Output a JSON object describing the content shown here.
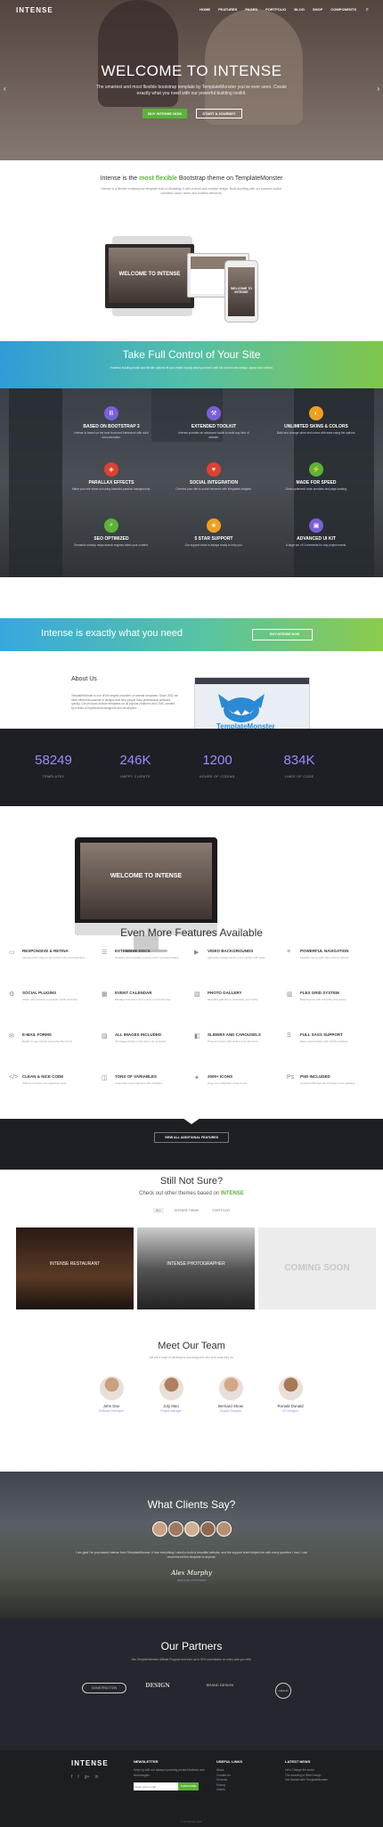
{
  "nav": {
    "logo": "INTENSE",
    "items": [
      "HOME",
      "FEATURES",
      "PAGES",
      "PORTFOLIO",
      "BLOG",
      "SHOP",
      "COMPONENTS"
    ]
  },
  "hero": {
    "title": "WELCOME TO INTENSE",
    "subtitle": "The smartest and most flexible bootstrap template by TemplateMonster you've ever seen. Create exactly what you need with our powerful building toolkit.",
    "btn_primary": "BUY INTENSE NOW",
    "btn_secondary": "START A JOURNEY"
  },
  "intro": {
    "heading_prefix": "Intense is the ",
    "heading_em": "most flexible",
    "heading_suffix": " Bootstrap theme on TemplateMonster",
    "body": "Intense is a flexible multipurpose template built on Bootstrap 3 with a clean and creative design. Build anything with our powerful toolkit, unlimited colors, skins, and endless elements."
  },
  "control": {
    "title": "Take Full Control of Your Site",
    "subtitle": "Powerful building toolkit and flexible options let you create exactly what you need, with full control over design, layout and content."
  },
  "features": [
    {
      "title": "BASED ON BOOTSTRAP 3",
      "desc": "Intense is based on the best front-end framework with solid documentation.",
      "color": "#7a5fd6",
      "icon": "bootstrap-icon"
    },
    {
      "title": "EXTENDED TOOLKIT",
      "desc": "Intense provides an advanced toolkit to build any kind of website.",
      "color": "#7a5fd6",
      "icon": "toolkit-icon"
    },
    {
      "title": "UNLIMITED SKINS & COLORS",
      "desc": "Build and change skins and colors with ease using the options.",
      "color": "#f0a020",
      "icon": "palette-icon"
    },
    {
      "title": "PARALLAX EFFECTS",
      "desc": "Make your site stand out using beautiful parallax backgrounds.",
      "color": "#e04030",
      "icon": "parallax-icon"
    },
    {
      "title": "SOCIAL INTEGRATION",
      "desc": "Connect your site to social networks with integrated widgets.",
      "color": "#e04030",
      "icon": "social-icon"
    },
    {
      "title": "MADE FOR SPEED",
      "desc": "Clean optimized code provides fast page loading.",
      "color": "#5bb33a",
      "icon": "speed-icon"
    },
    {
      "title": "SEO OPTIMIZED",
      "desc": "Semantic markup helps search engines index your content.",
      "color": "#5bb33a",
      "icon": "seo-icon"
    },
    {
      "title": "5 STAR SUPPORT",
      "desc": "Our support team is always ready to help you.",
      "color": "#f0a020",
      "icon": "support-icon"
    },
    {
      "title": "ADVANCED UI KIT",
      "desc": "A large set of UI elements for any project needs.",
      "color": "#7a5fd6",
      "icon": "uikit-icon"
    }
  ],
  "cta": {
    "title": "Intense is exactly what you need",
    "button": "BUY INTENSE NOW"
  },
  "about": {
    "title": "About Us",
    "body": "TemplateMonster is one of the largest providers of website templates. Since 2002 we have offered thousands of designs that help people build professional websites quickly. Our products include templates for all popular platforms and CMS, created by a team of experienced designers and developers.",
    "video_brand": "TemplateMonster"
  },
  "stats": [
    {
      "value": "58249",
      "label": "TEMPLATES"
    },
    {
      "value": "246K",
      "label": "HAPPY CLIENTS"
    },
    {
      "value": "1200",
      "label": "HOURS OF CODING"
    },
    {
      "value": "834K",
      "label": "LINES OF CODE"
    }
  ],
  "more_features": {
    "title": "Even More Features Available",
    "items": [
      {
        "title": "RESPONSIVE & RETINA",
        "desc": "Intense looks crisp on any screen size and resolution."
      },
      {
        "title": "EXTENSIVE DOCS",
        "desc": "Detailed documentation covers every template feature."
      },
      {
        "title": "VIDEO BACKGROUNDS",
        "desc": "Add video backgrounds to any section with ease."
      },
      {
        "title": "POWERFUL NAVIGATION",
        "desc": "Flexible menus with many layout options."
      },
      {
        "title": "SOCIAL PLUGINS",
        "desc": "Share your content on popular social networks."
      },
      {
        "title": "EVENT CALENDAR",
        "desc": "Manage and share your events in a simple way."
      },
      {
        "title": "PHOTO GALLERY",
        "desc": "Beautiful galleries to showcase your works."
      },
      {
        "title": "FLEX GRID SYSTEM",
        "desc": "Build layouts with a flexible grid system."
      },
      {
        "title": "E-MAIL FORMS",
        "desc": "Ready to use contact and subscribe forms."
      },
      {
        "title": "ALL IMAGES INCLUDED",
        "desc": "All images shown in the demo are included."
      },
      {
        "title": "SLIDERS AND CAROUSELS",
        "desc": "Present content with sliders and carousels."
      },
      {
        "title": "FULL SASS SUPPORT",
        "desc": "Easy customization with SASS variables."
      },
      {
        "title": "CLEAN & NICE CODE",
        "desc": "Well commented and organized code."
      },
      {
        "title": "TONS OF VARIABLES",
        "desc": "Customize every element with variables."
      },
      {
        "title": "2000+ ICONS",
        "desc": "Huge icon collection ready to use."
      },
      {
        "title": "PSD INCLUDED",
        "desc": "Layered PSD files are included in the package."
      }
    ],
    "button": "VIEW ALL ADDITIONAL FEATURES"
  },
  "not_sure": {
    "title": "Still Not Sure?",
    "sub_prefix": "Check out other themes based on ",
    "sub_em": "INTENSE",
    "tabs": [
      "ALL",
      "INTENSE THEME",
      "PORTFOLIO"
    ],
    "thumbs": [
      "INTENSE RESTAURANT",
      "INTENSE PHOTOGRAPHER",
      "COMING SOON"
    ]
  },
  "team": {
    "title": "Meet Our Team",
    "subtitle": "We are a team of developers and designers who love what they do.",
    "members": [
      {
        "name": "John Doe",
        "role": "Software Developer"
      },
      {
        "name": "July Mao",
        "role": "Project Manager"
      },
      {
        "name": "Bernard Show",
        "role": "Graphic Designer"
      },
      {
        "name": "Ronald Donald",
        "role": "UX Designer"
      }
    ]
  },
  "clients": {
    "title": "What Clients Say?",
    "quote": "I am glad I've purchased Intense from TemplateMonster. It has everything I need to build a beautiful website, and the support team helped me with every question I had. I can recommend this template to anyone.",
    "name": "Alex Murphy",
    "role": "REGULAR CUSTOMER"
  },
  "partners": {
    "title": "Our Partners",
    "subtitle": "Join TemplateMonster Affiliate Program and earn up to 30% commission on every sale you refer.",
    "logos": [
      "CONSTRUCTION",
      "DESIGN",
      "BRAND DESIGN",
      "GROUP"
    ]
  },
  "footer": {
    "logo": "INTENSE",
    "newsletter_title": "NEWSLETTER",
    "newsletter_text": "Keep up with our always upcoming product features and technologies.",
    "input_placeholder": "Enter your e-mail",
    "subscribe": "SUBSCRIBE",
    "links_title": "USEFUL LINKS",
    "links": [
      "About",
      "Contact Us",
      "Services",
      "Pricing",
      "Clients"
    ],
    "news_title": "LATEST NEWS",
    "news": [
      "Let's Change the world",
      "The meaning of Web Design",
      "Get Started with TemplateMonster"
    ],
    "copyright": "© INTENSE 2016"
  }
}
